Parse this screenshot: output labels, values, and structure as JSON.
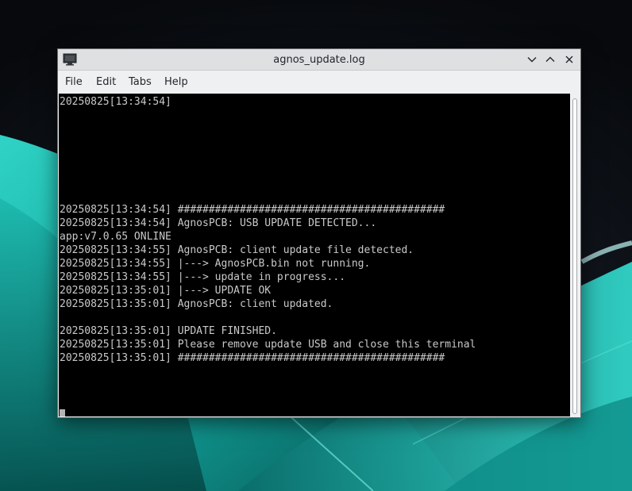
{
  "window": {
    "title": "agnos_update.log"
  },
  "menu": [
    "File",
    "Edit",
    "Tabs",
    "Help"
  ],
  "terminal": {
    "lines": [
      "20250825[13:34:54]",
      "",
      "",
      "",
      "",
      "",
      "",
      "",
      "20250825[13:34:54] ###########################################",
      "20250825[13:34:54] AgnosPCB: USB UPDATE DETECTED...",
      "app:v7.0.65 ONLINE",
      "20250825[13:34:55] AgnosPCB: client update file detected.",
      "20250825[13:34:55] |---> AgnosPCB.bin not running.",
      "20250825[13:34:55] |---> update in progress...",
      "20250825[13:35:01] |---> UPDATE OK",
      "20250825[13:35:01] AgnosPCB: client updated.",
      "",
      "20250825[13:35:01] UPDATE FINISHED.",
      "20250825[13:35:01] Please remove update USB and close this terminal",
      "20250825[13:35:01] ###########################################"
    ]
  },
  "colors": {
    "terminal_bg": "#000000",
    "terminal_fg": "#c9c9c9",
    "titlebar": "#dee0e2"
  }
}
